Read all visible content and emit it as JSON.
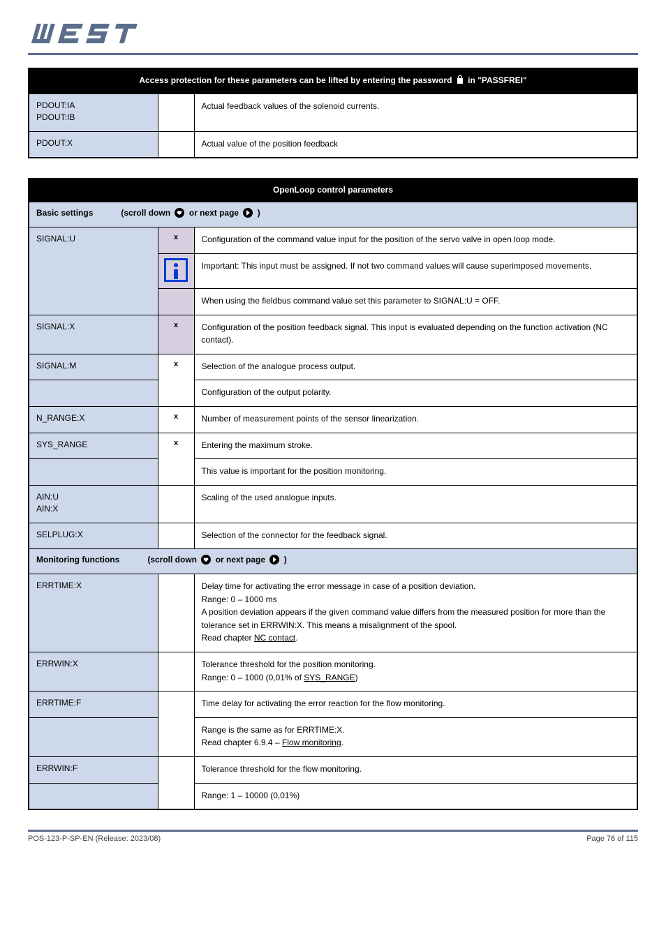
{
  "brand": "WEST",
  "footer": {
    "left": "POS-123-P-SP-EN (Release: 2023/08)",
    "right": "Page 76 of 115"
  },
  "icons": {
    "lock": "lock-icon",
    "heart": "heart-icon",
    "next": "next-icon"
  },
  "block1": {
    "header": "Access protection for these parameters can be lifted by entering the password in \"PASSFREI\"",
    "rows": [
      {
        "param": "PDOUT:IA\nPDOUT:IB",
        "code": "",
        "desc": "Actual feedback values of the solenoid currents."
      },
      {
        "param": "PDOUT:X",
        "code": "",
        "desc": "Actual value of the position feedback"
      }
    ]
  },
  "block2": {
    "header": "OpenLoop control parameters",
    "sub1": {
      "title": "Basic settings",
      "hint": "(scroll down     or next page    )",
      "rows": [
        {
          "param": "SIGNAL:U",
          "code": "x",
          "desc": "Configuration of the command value input for the position of the servo valve in open loop mode.",
          "info": "Important: This input must be assigned. If not two command values will cause superimposed movements.",
          "foot": "When using the fieldbus command value set this parameter to SIGNAL:U = OFF."
        },
        {
          "param": "SIGNAL:X",
          "code": "x",
          "desc": "Configuration of the position feedback signal. This input is evaluated depending on the function activation (NC contact)."
        },
        {
          "param": "SIGNAL:M",
          "code": "x",
          "desc": "Selection of the analogue process output."
        },
        {
          "param": "",
          "code": "",
          "desc": "Configuration of the output polarity.",
          "dashTop": true
        },
        {
          "param": "N_RANGE:X",
          "code": "x",
          "desc": "Number of measurement points of the sensor linearization."
        },
        {
          "param": "SYS_RANGE",
          "code": "x",
          "desc": "Entering the maximum stroke."
        },
        {
          "param": "",
          "code": "",
          "desc": "This value is important for the position monitoring.",
          "dashTop": true
        },
        {
          "param": "AIN:U\nAIN:X",
          "code": "",
          "desc": "Scaling of the used analogue inputs."
        },
        {
          "param": "SELPLUG:X",
          "code": "",
          "desc": "Selection of the connector for the feedback signal."
        }
      ]
    },
    "sub2": {
      "title": "Monitoring functions",
      "hint": "(scroll down     or next page    )",
      "rows": [
        {
          "param": "ERRTIME:X",
          "code": "",
          "desc": "Delay time for activating the error message in case of a position deviation.\nRange: 0 – 1000 ms\nA position deviation appears if the given command value differs from the measured position for more than the tolerance set in ERRWIN:X. This means a misalignment of the spool.\nRead chapter  NC contact ."
        },
        {
          "param": "ERRWIN:X",
          "code": "",
          "desc": "Tolerance threshold for the position monitoring.\nRange: 0 – 1000 (0,01% of SYS_RANGE)"
        },
        {
          "param": "ERRTIME:F",
          "code": "",
          "desc": "Time delay for activating the error reaction for the flow monitoring."
        },
        {
          "param": "",
          "code": "",
          "desc": "Range is the same as for ERRTIME:X.\nRead chapter 6.9.4 – Flow monitoring.",
          "dashTop": true
        },
        {
          "param": "ERRWIN:F",
          "code": "",
          "desc": "Tolerance threshold for the flow monitoring."
        },
        {
          "param": "",
          "code": "",
          "desc": "Range: 1 – 10000 (0,01%)",
          "dashTop": true
        }
      ]
    }
  }
}
